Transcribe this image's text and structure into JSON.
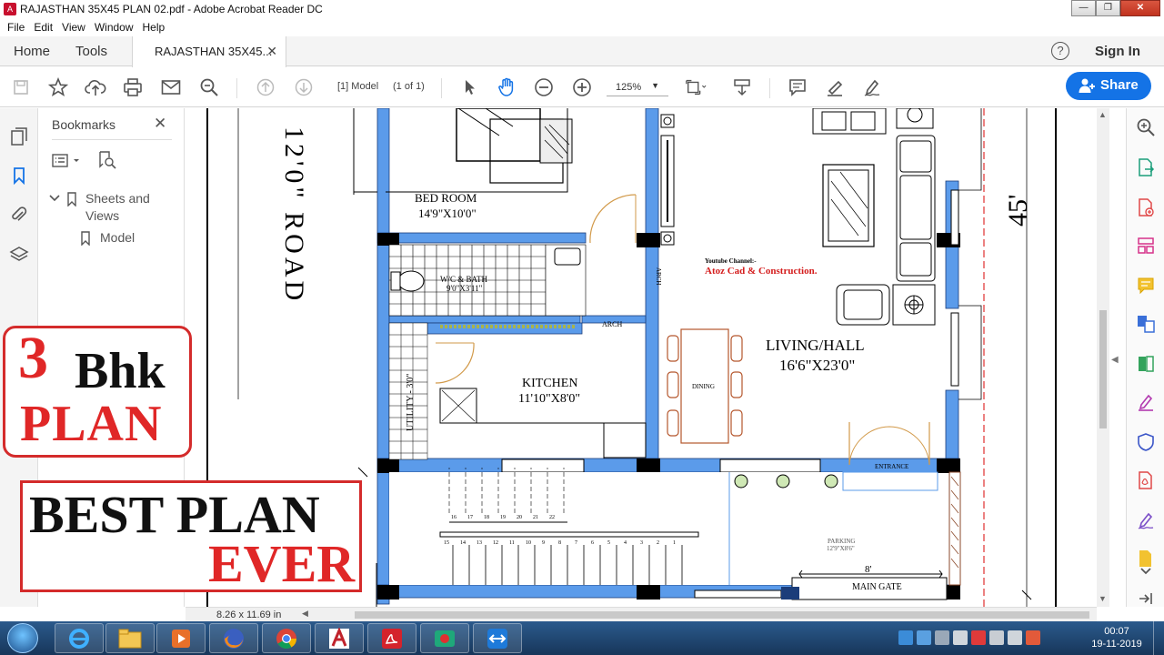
{
  "window": {
    "title": "RAJASTHAN 35X45 PLAN 02.pdf - Adobe Acrobat Reader DC",
    "controls": [
      "—",
      "❐",
      "✕"
    ]
  },
  "menu": [
    "File",
    "Edit",
    "View",
    "Window",
    "Help"
  ],
  "tabs": {
    "home": "Home",
    "tools": "Tools",
    "document": "RAJASTHAN 35X45...",
    "help": "?",
    "signin": "Sign In"
  },
  "toolbar": {
    "page_label": "[1] Model",
    "page_count": "(1 of 1)",
    "zoom": "125%",
    "share": "Share"
  },
  "bookmarks": {
    "title": "Bookmarks",
    "tree": [
      {
        "label": "Sheets and Views",
        "line1": "Sheets and",
        "line2": "Views"
      },
      {
        "label": "Model"
      }
    ]
  },
  "drawing": {
    "road": "12'0\" ROAD",
    "depth": "45'",
    "bedroom": "BED ROOM",
    "bedroom_size": "14'9\"X10'0\"",
    "bath": "W/C & BATH",
    "bath_size": "9'0\"X3'11\"",
    "kitchen": "KITCHEN",
    "kitchen_size": "11'10\"X8'0\"",
    "living": "LIVING/HALL",
    "living_size": "16'6\"X23'0\"",
    "dining": "DINING",
    "utility": "UTILITY - 3'0\"",
    "arch": "ARCH",
    "channel_label": "Youtube Channel:-",
    "channel_name": "Atoz Cad & Construction.",
    "entrance": "ENTRANCE",
    "parking": "PARKING",
    "parking_size": "12'9\"X8'6\"",
    "gate_width": "8'",
    "main_gate": "MAIN GATE",
    "steps_upper": [
      "16",
      "17",
      "18",
      "19",
      "20",
      "21",
      "22"
    ],
    "steps_lower": [
      "15",
      "14",
      "13",
      "12",
      "11",
      "10",
      "9",
      "8",
      "7",
      "6",
      "5",
      "4",
      "3",
      "2",
      "1"
    ]
  },
  "overlay": {
    "three": "3",
    "bhk": "Bhk",
    "plan": "PLAN",
    "best": "BEST PLAN",
    "ever": "EVER"
  },
  "status": {
    "page_size": "8.26 x 11.69 in"
  },
  "clock": {
    "time": "00:07",
    "date": "19-11-2019"
  },
  "colors": {
    "wall_blue": "#5b9bea",
    "accent_red": "#e02727",
    "share_blue": "#1473e6",
    "taskbar": "#1f4a78"
  }
}
